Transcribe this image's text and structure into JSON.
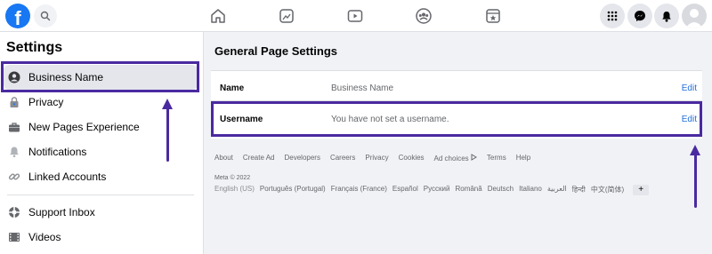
{
  "topbar": {
    "logo": "f",
    "icons": [
      "search-icon",
      "home-icon",
      "pages-icon",
      "watch-icon",
      "groups-icon",
      "gaming-icon",
      "menu-grid-icon",
      "messenger-icon",
      "notifications-icon",
      "profile-avatar"
    ]
  },
  "sidebar": {
    "title": "Settings",
    "items": [
      {
        "label": "Business Name",
        "icon": "profile-icon",
        "active": true
      },
      {
        "label": "Privacy",
        "icon": "lock-icon"
      },
      {
        "label": "New Pages Experience",
        "icon": "briefcase-icon"
      },
      {
        "label": "Notifications",
        "icon": "bell-icon"
      },
      {
        "label": "Linked Accounts",
        "icon": "link-icon"
      },
      {
        "label": "Support Inbox",
        "icon": "lifebuoy-icon"
      },
      {
        "label": "Videos",
        "icon": "film-icon"
      }
    ]
  },
  "main": {
    "title": "General Page Settings",
    "rows": [
      {
        "key": "Name",
        "value": "Business Name",
        "action": "Edit"
      },
      {
        "key": "Username",
        "value": "You have not set a username.",
        "action": "Edit"
      }
    ]
  },
  "footer": {
    "links": [
      "About",
      "Create Ad",
      "Developers",
      "Careers",
      "Privacy",
      "Cookies",
      "Ad choices",
      "Terms",
      "Help"
    ],
    "copyright": "Meta © 2022",
    "languages": [
      "English (US)",
      "Português (Portugal)",
      "Français (France)",
      "Español",
      "Русский",
      "Română",
      "Deutsch",
      "Italiano",
      "العربية",
      "हिन्दी",
      "中文(简体)"
    ],
    "add_language": "+"
  },
  "colors": {
    "brand": "#1877f2",
    "annotation": "#4a2aa0",
    "link": "#216fdb"
  }
}
